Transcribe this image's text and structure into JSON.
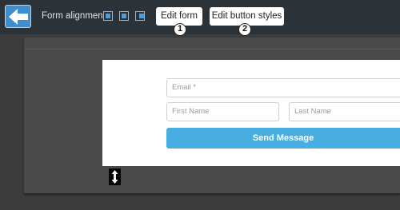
{
  "toolbar": {
    "back_button_icon": "arrow-left-icon",
    "alignment_label": "Form alignment",
    "alignment_options": [
      "align-left-icon",
      "align-center-icon",
      "align-right-icon"
    ],
    "edit_form_label": "Edit form",
    "edit_button_styles_label": "Edit button styles",
    "steps": [
      "1",
      "2"
    ]
  },
  "form": {
    "email_placeholder": "Email *",
    "first_name_placeholder": "First Name",
    "last_name_placeholder": "Last Name",
    "submit_label": "Send Message"
  },
  "resize_handle_icon": "vertical-resize-icon",
  "colors": {
    "toolbar_bg": "#2b3238",
    "accent_blue": "#48aee2",
    "canvas_bg": "#3c3c3c"
  }
}
